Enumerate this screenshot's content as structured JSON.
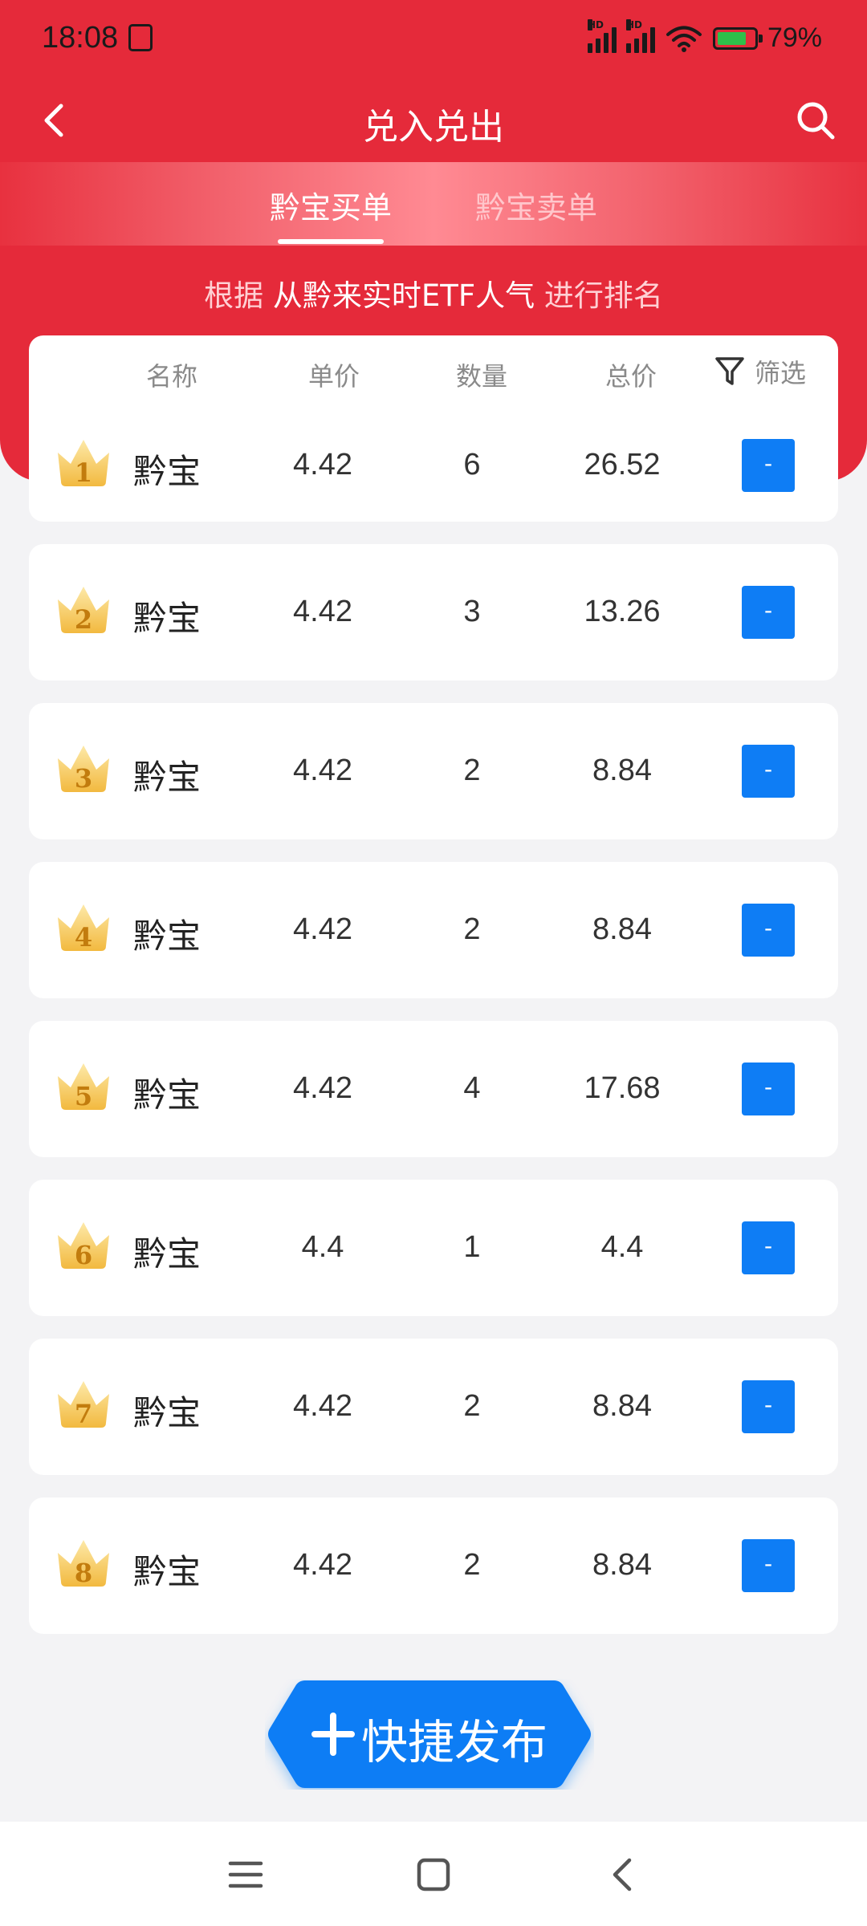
{
  "status_bar": {
    "time": "18:08",
    "signal_label": "HD",
    "battery_pct": "79%",
    "battery_level": 0.79
  },
  "header": {
    "title": "兑入兑出",
    "back_icon": "chevron-left-icon",
    "search_icon": "search-icon"
  },
  "tabs": [
    {
      "label": "黔宝买单",
      "active": true
    },
    {
      "label": "黔宝卖单",
      "active": false
    }
  ],
  "subtitle": {
    "prefix": "根据",
    "highlight": "从黔来实时ETF人气",
    "suffix": "进行排名"
  },
  "table": {
    "columns": {
      "name": "名称",
      "price": "单价",
      "qty": "数量",
      "total": "总价",
      "filter": "筛选"
    },
    "rows": [
      {
        "rank": "1",
        "name": "黔宝",
        "price": "4.42",
        "qty": "6",
        "total": "26.52",
        "action": "-"
      },
      {
        "rank": "2",
        "name": "黔宝",
        "price": "4.42",
        "qty": "3",
        "total": "13.26",
        "action": "-"
      },
      {
        "rank": "3",
        "name": "黔宝",
        "price": "4.42",
        "qty": "2",
        "total": "8.84",
        "action": "-"
      },
      {
        "rank": "4",
        "name": "黔宝",
        "price": "4.42",
        "qty": "2",
        "total": "8.84",
        "action": "-"
      },
      {
        "rank": "5",
        "name": "黔宝",
        "price": "4.42",
        "qty": "4",
        "total": "17.68",
        "action": "-"
      },
      {
        "rank": "6",
        "name": "黔宝",
        "price": "4.4",
        "qty": "1",
        "total": "4.4",
        "action": "-"
      },
      {
        "rank": "7",
        "name": "黔宝",
        "price": "4.42",
        "qty": "2",
        "total": "8.84",
        "action": "-"
      },
      {
        "rank": "8",
        "name": "黔宝",
        "price": "4.42",
        "qty": "2",
        "total": "8.84",
        "action": "-"
      }
    ]
  },
  "fab": {
    "label": "快捷发布"
  },
  "colors": {
    "brand_red": "#e52a3a",
    "action_blue": "#0e7df5",
    "crown_gold": "#f5c24a"
  }
}
